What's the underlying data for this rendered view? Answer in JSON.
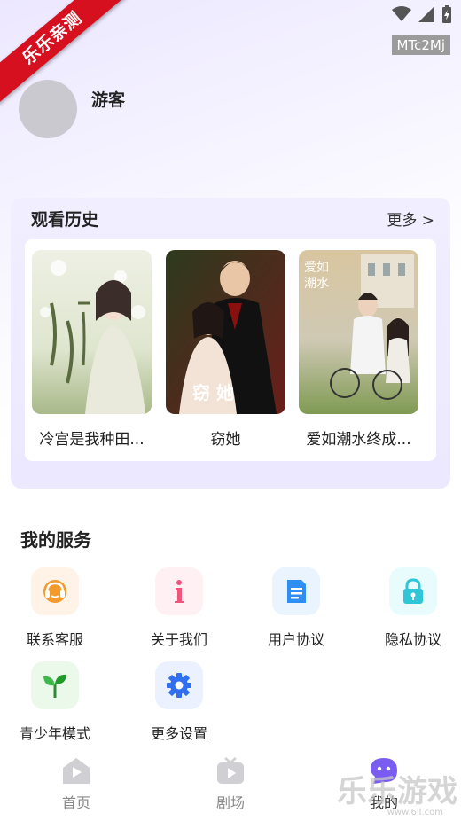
{
  "status": {
    "ribbon_text": "乐乐亲测",
    "id_tag": "MTc2Mj"
  },
  "profile": {
    "username": "游客"
  },
  "history": {
    "title": "观看历史",
    "more_label": "更多 >",
    "items": [
      {
        "title": "冷宫是我种田..."
      },
      {
        "title": "窃她"
      },
      {
        "title": "爱如潮水终成..."
      }
    ]
  },
  "services": {
    "title": "我的服务",
    "items": [
      {
        "label": "联系客服",
        "icon": "headset-icon",
        "color": "#f39a2e"
      },
      {
        "label": "关于我们",
        "icon": "info-icon",
        "color": "#f0557e"
      },
      {
        "label": "用户协议",
        "icon": "document-icon",
        "color": "#2f8ef4"
      },
      {
        "label": "隐私协议",
        "icon": "lock-icon",
        "color": "#2fc7d8"
      },
      {
        "label": "青少年模式",
        "icon": "sprout-icon",
        "color": "#3fb84a"
      },
      {
        "label": "更多设置",
        "icon": "gear-icon",
        "color": "#2f6ff0"
      }
    ]
  },
  "tabbar": {
    "tabs": [
      {
        "label": "首页",
        "icon": "home-icon"
      },
      {
        "label": "剧场",
        "icon": "tv-icon"
      },
      {
        "label": "我的",
        "icon": "profile-face-icon"
      }
    ]
  },
  "watermark": {
    "text": "乐乐游戏",
    "url": "www.6ll.com"
  }
}
